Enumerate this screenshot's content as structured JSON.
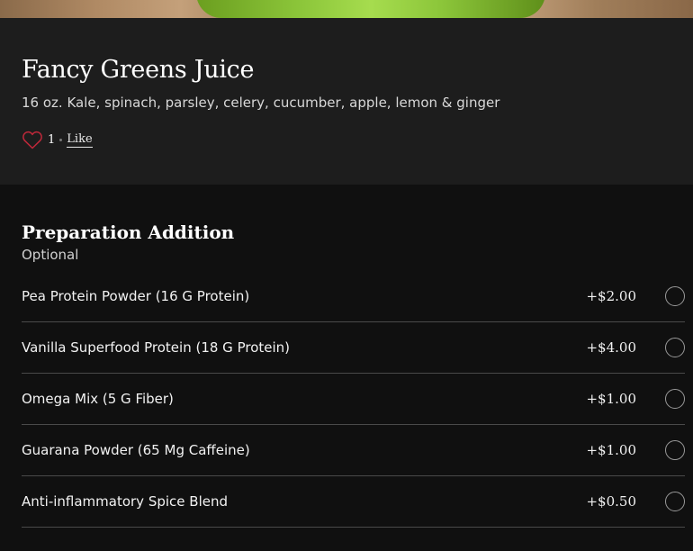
{
  "item": {
    "title": "Fancy Greens Juice",
    "description": "16 oz. Kale, spinach, parsley, celery, cucumber, apple, lemon & ginger",
    "like_count": "1",
    "like_label": "Like"
  },
  "section": {
    "title": "Preparation Addition",
    "subtitle": "Optional",
    "options": [
      {
        "name": "Pea Protein Powder (16 G Protein)",
        "price": "+$2.00",
        "selected": false
      },
      {
        "name": "Vanilla Superfood Protein (18 G Protein)",
        "price": "+$4.00",
        "selected": false
      },
      {
        "name": "Omega Mix (5 G Fiber)",
        "price": "+$1.00",
        "selected": false
      },
      {
        "name": "Guarana Powder (65 Mg Caffeine)",
        "price": "+$1.00",
        "selected": false
      },
      {
        "name": "Anti-inflammatory Spice Blend",
        "price": "+$0.50",
        "selected": false
      }
    ]
  },
  "icons": {
    "heart": "heart-outline-icon",
    "radio": "radio-unchecked"
  },
  "colors": {
    "heart": "#c0283a",
    "background": "#101010",
    "info_background": "#1d1d1d",
    "divider": "#4a4a4a"
  }
}
